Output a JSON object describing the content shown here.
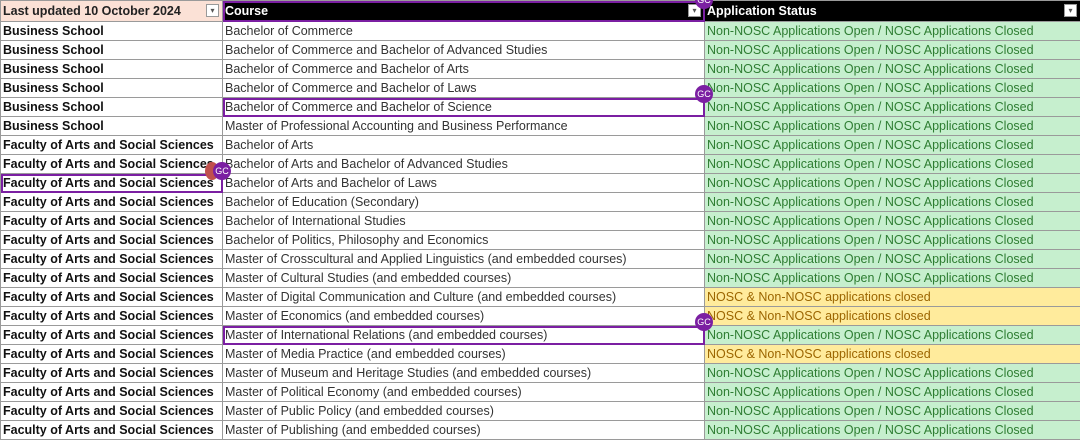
{
  "header": {
    "col_a": "Last updated 10 October 2024",
    "col_b": "Course",
    "col_c": "Application Status"
  },
  "collaborator": "GC",
  "colors": {
    "open_bg": "#c6efce",
    "open_text": "#2e7d32",
    "closed_bg": "#ffeb9c",
    "closed_text": "#9c6500",
    "presence": "#7b1fa2"
  },
  "rows": [
    {
      "faculty": "Business School",
      "course": "Bachelor of Commerce",
      "status": "Non-NOSC Applications Open / NOSC Applications Closed",
      "type": "open"
    },
    {
      "faculty": "Business School",
      "course": "Bachelor of Commerce and Bachelor of Advanced Studies",
      "status": "Non-NOSC Applications Open / NOSC Applications Closed",
      "type": "open"
    },
    {
      "faculty": "Business School",
      "course": "Bachelor of Commerce and Bachelor of Arts",
      "status": "Non-NOSC Applications Open / NOSC Applications Closed",
      "type": "open"
    },
    {
      "faculty": "Business School",
      "course": "Bachelor of Commerce and Bachelor of Laws",
      "status": "Non-NOSC Applications Open / NOSC Applications Closed",
      "type": "open"
    },
    {
      "faculty": "Business School",
      "course": "Bachelor of Commerce and Bachelor of Science",
      "status": "Non-NOSC Applications Open / NOSC Applications Closed",
      "type": "open"
    },
    {
      "faculty": "Business School",
      "course": "Master of Professional Accounting and Business Performance",
      "status": "Non-NOSC Applications Open / NOSC Applications Closed",
      "type": "open"
    },
    {
      "faculty": "Faculty of Arts and Social Sciences",
      "course": "Bachelor of Arts",
      "status": "Non-NOSC Applications Open / NOSC Applications Closed",
      "type": "open"
    },
    {
      "faculty": "Faculty of Arts and Social Sciences",
      "course": "Bachelor of Arts and Bachelor of Advanced Studies",
      "status": "Non-NOSC Applications Open / NOSC Applications Closed",
      "type": "open"
    },
    {
      "faculty": "Faculty of Arts and Social Sciences",
      "course": "Bachelor of Arts and Bachelor of Laws",
      "status": "Non-NOSC Applications Open / NOSC Applications Closed",
      "type": "open"
    },
    {
      "faculty": "Faculty of Arts and Social Sciences",
      "course": "Bachelor of Education (Secondary)",
      "status": "Non-NOSC Applications Open / NOSC Applications Closed",
      "type": "open"
    },
    {
      "faculty": "Faculty of Arts and Social Sciences",
      "course": "Bachelor of International Studies",
      "status": "Non-NOSC Applications Open / NOSC Applications Closed",
      "type": "open"
    },
    {
      "faculty": "Faculty of Arts and Social Sciences",
      "course": "Bachelor of Politics, Philosophy and Economics",
      "status": "Non-NOSC Applications Open / NOSC Applications Closed",
      "type": "open"
    },
    {
      "faculty": "Faculty of Arts and Social Sciences",
      "course": "Master of Crosscultural and Applied Linguistics (and embedded courses)",
      "status": "Non-NOSC Applications Open / NOSC Applications Closed",
      "type": "open"
    },
    {
      "faculty": "Faculty of Arts and Social Sciences",
      "course": "Master of Cultural Studies (and embedded courses)",
      "status": "Non-NOSC Applications Open / NOSC Applications Closed",
      "type": "open"
    },
    {
      "faculty": "Faculty of Arts and Social Sciences",
      "course": "Master of Digital Communication and Culture (and embedded courses)",
      "status": "NOSC & Non-NOSC applications closed",
      "type": "closed"
    },
    {
      "faculty": "Faculty of Arts and Social Sciences",
      "course": "Master of Economics (and embedded courses)",
      "status": "NOSC & Non-NOSC applications closed",
      "type": "closed"
    },
    {
      "faculty": "Faculty of Arts and Social Sciences",
      "course": "Master of International Relations (and embedded courses)",
      "status": "Non-NOSC Applications Open / NOSC Applications Closed",
      "type": "open"
    },
    {
      "faculty": "Faculty of Arts and Social Sciences",
      "course": "Master of Media Practice (and embedded courses)",
      "status": "NOSC & Non-NOSC applications closed",
      "type": "closed"
    },
    {
      "faculty": "Faculty of Arts and Social Sciences",
      "course": "Master of Museum and Heritage Studies (and embedded courses)",
      "status": "Non-NOSC Applications Open / NOSC Applications Closed",
      "type": "open"
    },
    {
      "faculty": "Faculty of Arts and Social Sciences",
      "course": "Master of Political Economy (and embedded courses)",
      "status": "Non-NOSC Applications Open / NOSC Applications Closed",
      "type": "open"
    },
    {
      "faculty": "Faculty of Arts and Social Sciences",
      "course": "Master of Public Policy (and embedded courses)",
      "status": "Non-NOSC Applications Open / NOSC Applications Closed",
      "type": "open"
    },
    {
      "faculty": "Faculty of Arts and Social Sciences",
      "course": "Master of Publishing (and embedded courses)",
      "status": "Non-NOSC Applications Open / NOSC Applications Closed",
      "type": "open"
    }
  ]
}
